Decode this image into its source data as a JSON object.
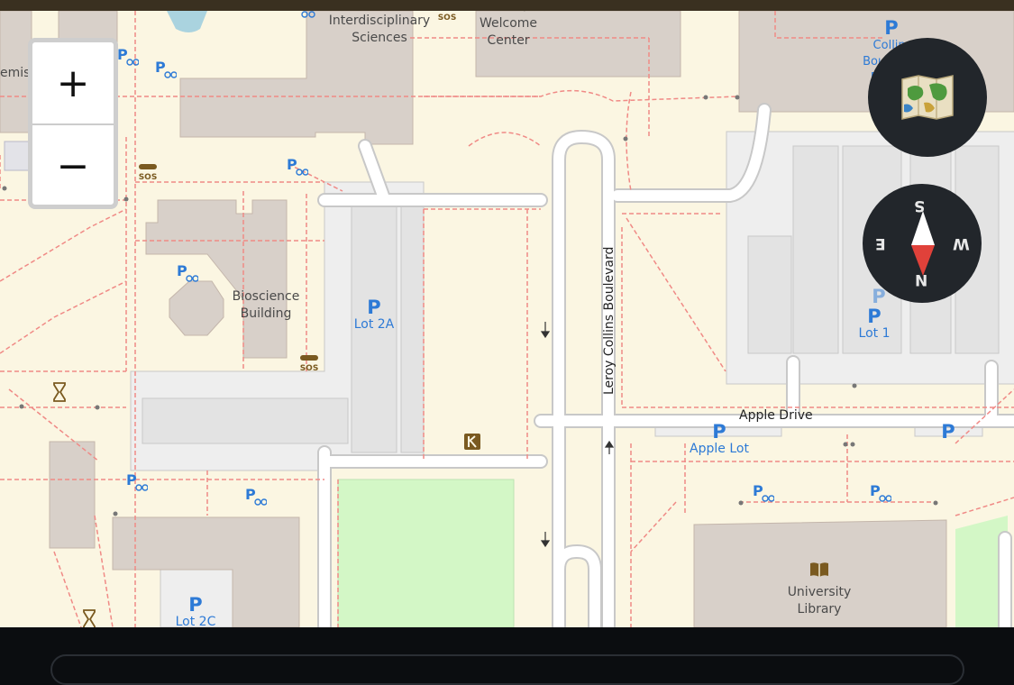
{
  "map": {
    "buildings": {
      "interdisciplinary": "Interdisciplinary\nSciences",
      "welcome_center": "Allen /\nWelcome\nCenter",
      "bioscience": "Bioscience\nBuilding",
      "university_library": "University\nLibrary",
      "chemistry_partial": "emist",
      "collins_partial": "Collins\nBoulevard\nParking\nFacility"
    },
    "roads": {
      "leroy_collins": "Leroy Collins Boulevard",
      "apple_drive": "Apple Drive"
    },
    "parking": {
      "symbol": "P",
      "lot_2a": "Lot 2A",
      "lot_1": "Lot 1",
      "apple_lot": "Apple Lot",
      "lot_2c": "Lot 2C"
    },
    "poi_icons": [
      "bicycle-parking-icon",
      "emergency-phone-icon",
      "library-icon",
      "shop-icon",
      "hourglass-icon"
    ],
    "emergency_phone_label": "SOS"
  },
  "controls": {
    "zoom_in": "+",
    "zoom_out": "−",
    "layers_icon": "map-layers-icon",
    "compass": {
      "n": "N",
      "s": "S",
      "e": "E",
      "w": "W"
    }
  },
  "colors": {
    "background": "#fbf6e2",
    "building": "#d8d0c9",
    "parking_area": "#eeeeee",
    "pitch": "#d3f7c6",
    "footway": "#f08a86",
    "parking_blue": "#2d7ad6",
    "control_dark": "#22262b"
  }
}
